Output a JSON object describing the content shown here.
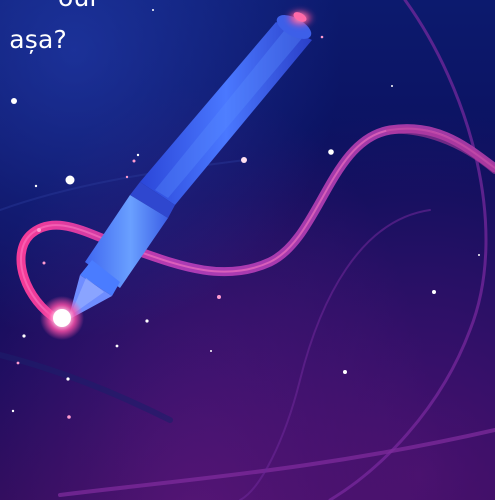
{
  "caption": {
    "line1": "our",
    "line2": "i așa?"
  },
  "colors": {
    "background_top": "#0c1a6e",
    "background_bottom": "#2a0c5a",
    "ribbon": "#c03aa8",
    "pen_body": "#3f6df2",
    "pen_tip_glow": "#ff5fb0",
    "text": "#ffffff"
  },
  "icons": {
    "pen": "digital-pen-stylus"
  }
}
